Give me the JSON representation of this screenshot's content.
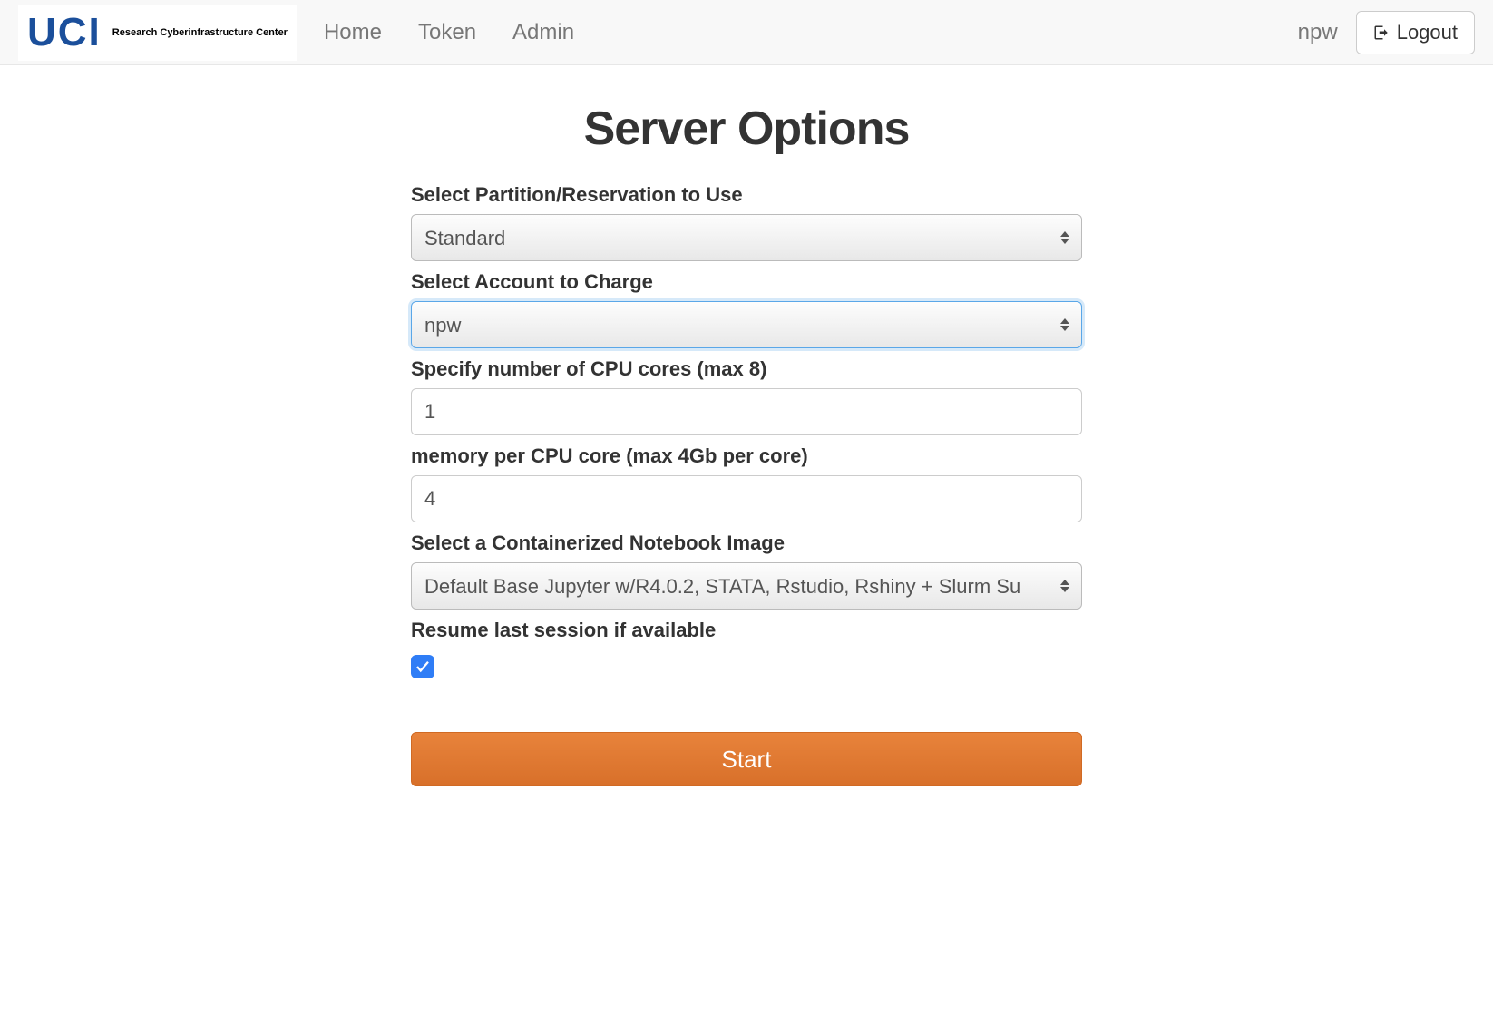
{
  "brand": {
    "logo_text": "UCI",
    "sub_text": "Research Cyberinfrastructure Center"
  },
  "nav": {
    "links": [
      "Home",
      "Token",
      "Admin"
    ],
    "username": "npw",
    "logout_label": "Logout"
  },
  "page": {
    "title": "Server Options"
  },
  "form": {
    "partition_label": "Select Partition/Reservation to Use",
    "partition_value": "Standard",
    "account_label": "Select Account to Charge",
    "account_value": "npw",
    "cpu_label": "Specify number of CPU cores (max 8)",
    "cpu_value": "1",
    "memory_label": "memory per CPU core (max 4Gb per core)",
    "memory_value": "4",
    "image_label": "Select a Containerized Notebook Image",
    "image_value": "Default Base Jupyter w/R4.0.2, STATA, Rstudio, Rshiny + Slurm Su",
    "resume_label": "Resume last session if available",
    "resume_checked": true,
    "start_label": "Start"
  }
}
